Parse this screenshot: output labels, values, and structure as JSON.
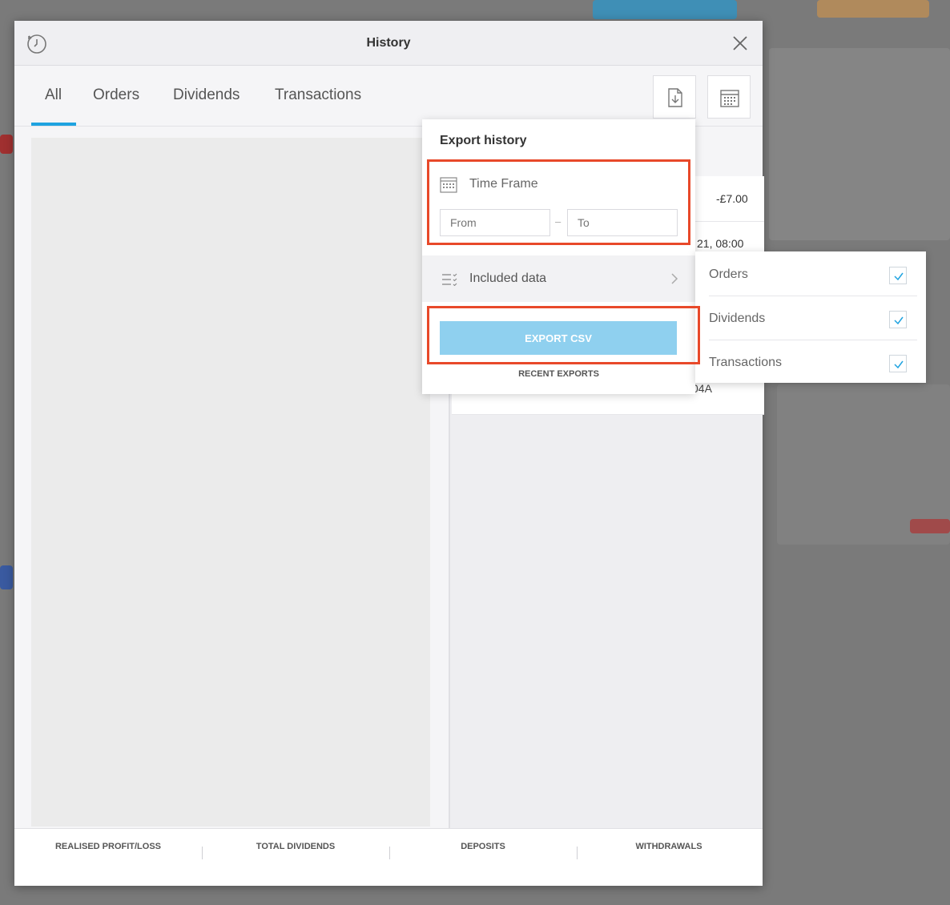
{
  "modal": {
    "title": "History",
    "icons": {
      "history": "history-clock-icon",
      "close": "close-icon",
      "export": "file-download-icon",
      "calendar": "calendar-icon"
    }
  },
  "tabs": [
    {
      "label": "All",
      "active": true
    },
    {
      "label": "Orders",
      "active": false
    },
    {
      "label": "Dividends",
      "active": false
    },
    {
      "label": "Transactions",
      "active": false
    }
  ],
  "list": {
    "amount": "-£7.00",
    "partial_date": "21, 08:00",
    "partial_code": "04A"
  },
  "footer": {
    "items": [
      "REALISED PROFIT/LOSS",
      "TOTAL DIVIDENDS",
      "DEPOSITS",
      "WITHDRAWALS"
    ]
  },
  "export_panel": {
    "title": "Export history",
    "time_frame_label": "Time Frame",
    "from_placeholder": "From",
    "to_placeholder": "To",
    "included_data_label": "Included data",
    "export_button": "EXPORT CSV",
    "recent_exports": "RECENT EXPORTS"
  },
  "included_data_menu": [
    {
      "label": "Orders",
      "checked": true
    },
    {
      "label": "Dividends",
      "checked": true
    },
    {
      "label": "Transactions",
      "checked": true
    }
  ],
  "colors": {
    "accent": "#1fa3e0",
    "button": "#8fd0ef",
    "highlight": "#e8492a"
  }
}
